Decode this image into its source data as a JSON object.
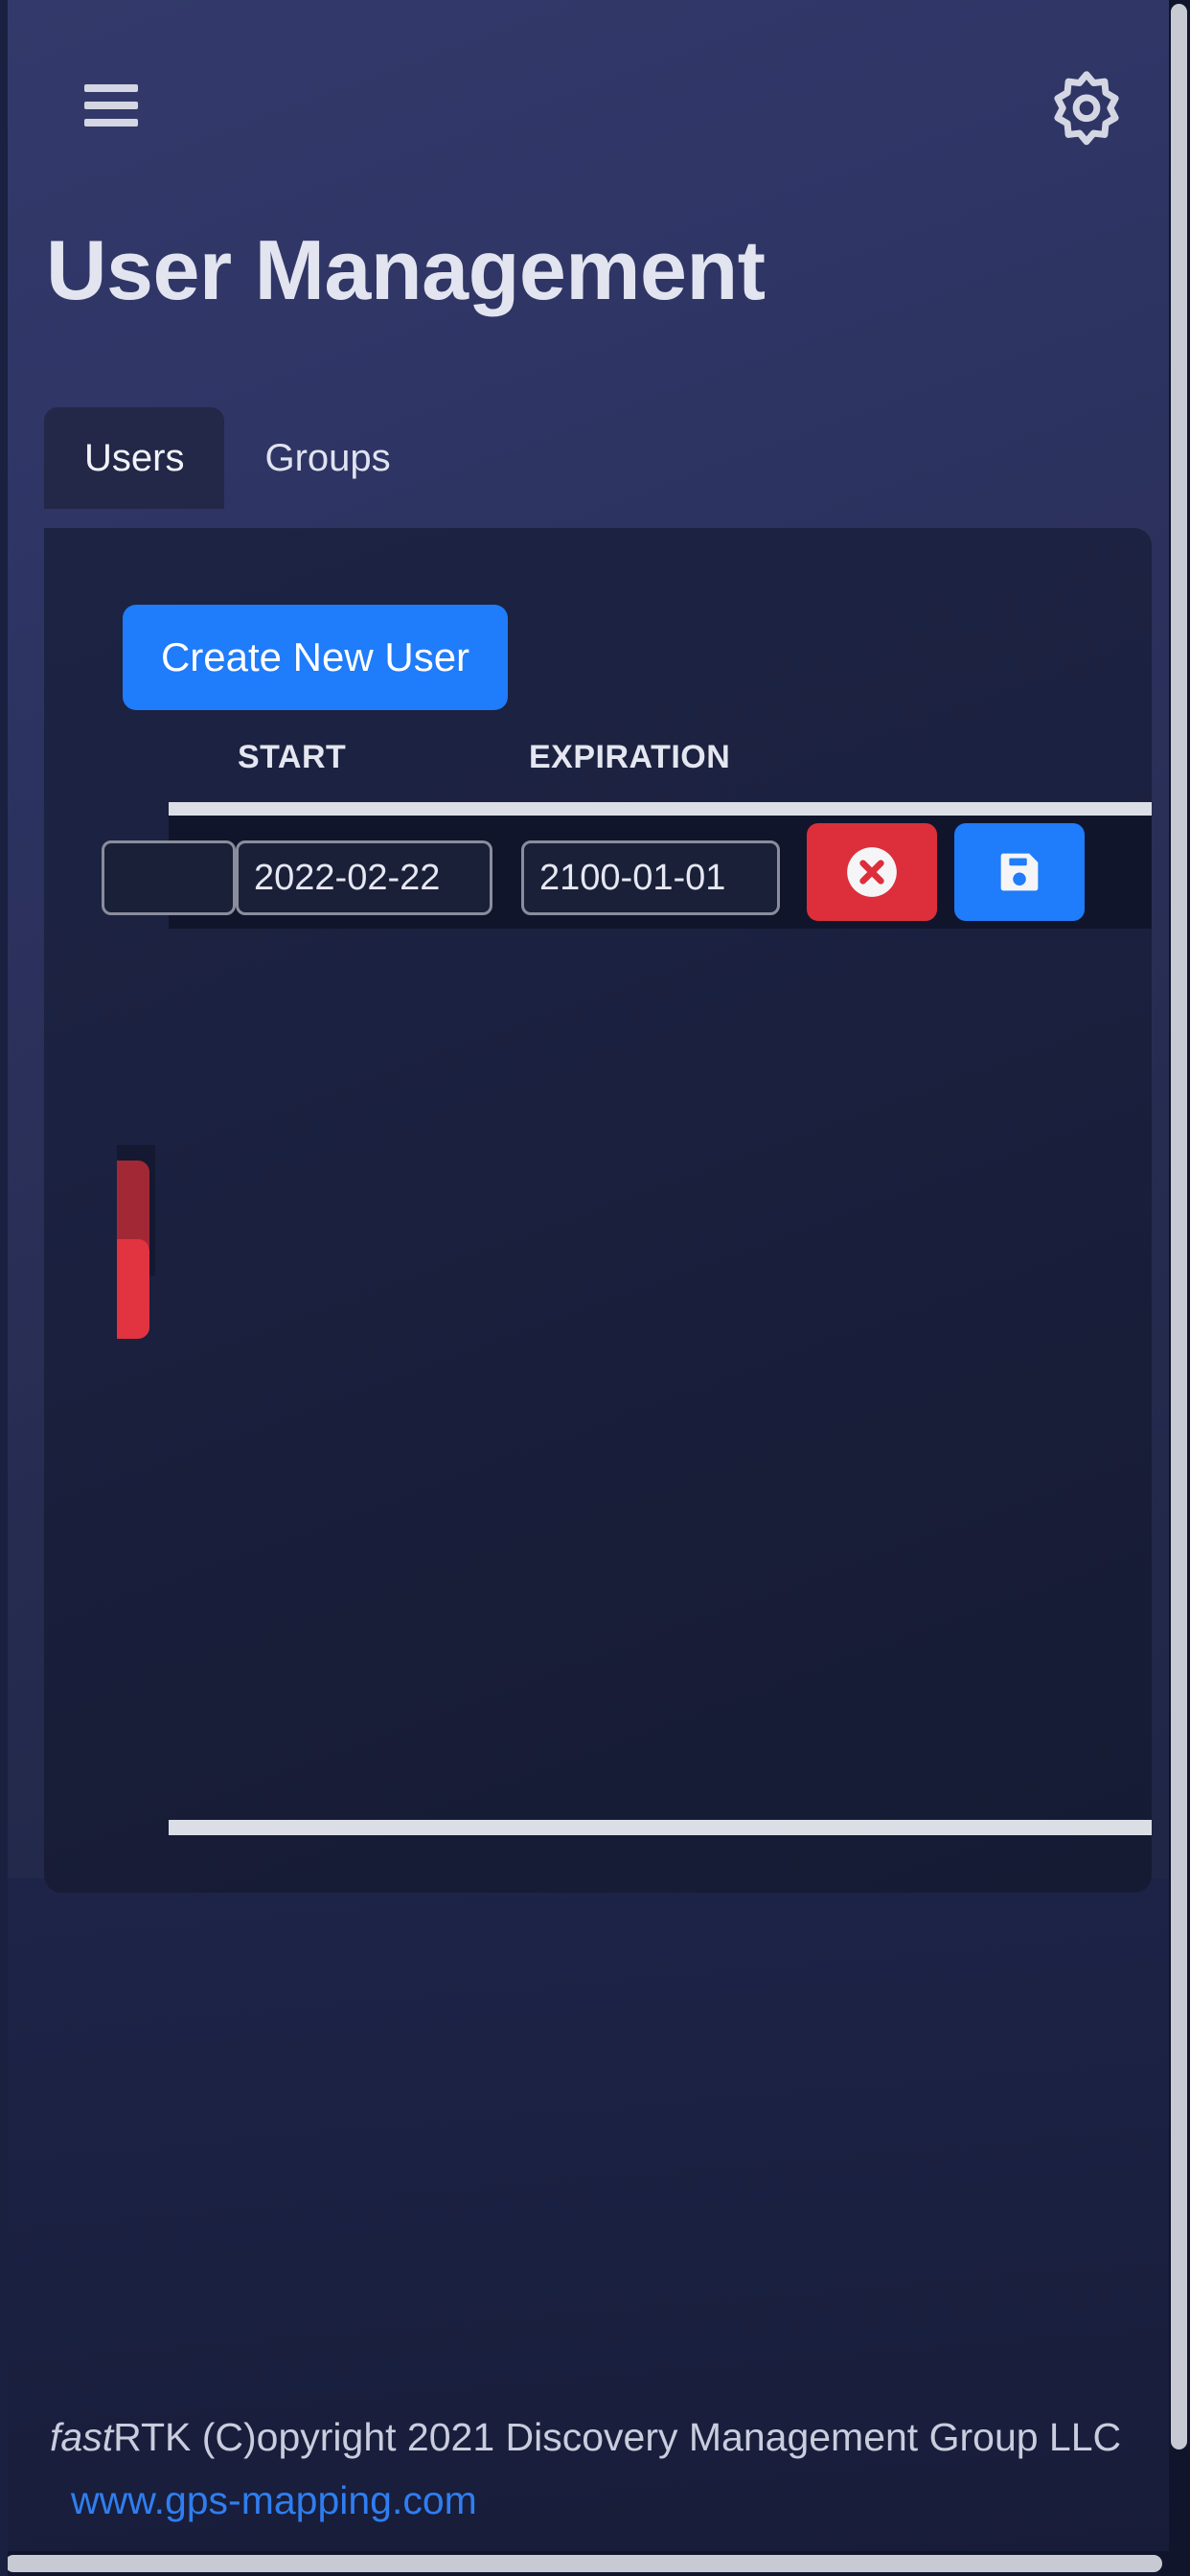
{
  "header": {
    "menu_icon": "hamburger-menu-icon",
    "settings_icon": "gear-icon"
  },
  "page": {
    "title": "User Management"
  },
  "tabs": [
    {
      "label": "Users",
      "active": true
    },
    {
      "label": "Groups",
      "active": false
    }
  ],
  "toolbar": {
    "create_label": "Create New User"
  },
  "table": {
    "columns": [
      {
        "key": "start",
        "label": "START"
      },
      {
        "key": "expiration",
        "label": "EXPIRATION"
      }
    ],
    "editing_row": {
      "clipped_value": "",
      "start_value": "2022-02-22",
      "expiration_value": "2100-01-01",
      "start_placeholder": "YYYY-MM-DD",
      "expiration_placeholder": "YYYY-MM-DD",
      "cancel_icon": "cancel-circle-x-icon",
      "save_icon": "floppy-disk-save-icon"
    }
  },
  "footer": {
    "brand_italic": "fast",
    "brand_rest": "RTK",
    "copyright": "  (C)opyright 2021 Discovery Management Group LLC",
    "link": "www.gps-mapping.com"
  },
  "colors": {
    "accent_blue": "#1f7cfa",
    "danger_red": "#dc2f3b",
    "card_bg": "#1d2342",
    "page_bg": "#2e3563",
    "link_blue": "#2f7ef0",
    "text_light": "#e2e4ef"
  }
}
